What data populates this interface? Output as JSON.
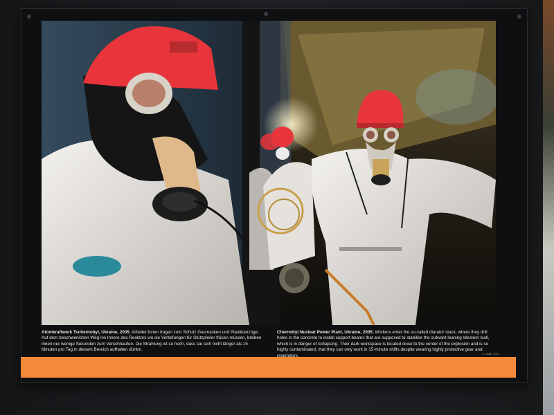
{
  "captions": {
    "german": {
      "title": "Atomkraftwerk Tschernobyl, Ukraine, 2005.",
      "body": "Arbeiter:innen tragen zum Schutz Gasmasken und Plastikanzüge. Auf dem beschwerlichen Weg ins Innere des Reaktors wo sie Vertiefungen für Stützpfeiler fräsen müssen, bleiben ihnen nur wenige Sekunden zum Verschnaufen. Die Strahlung ist so hoch, dass sie sich nicht länger als 15 Minuten pro Tag in diesem Bereich aufhalten dürfen."
    },
    "english": {
      "title": "Chernobyl Nuclear Power Plant, Ukraine, 2005.",
      "body": "Workers enter the so-called diarator stack, where they drill holes in the concrete to install support beams that are supposed to stabilise the outward leaning Western wall, which is in danger of collapsing. Their dark workspace is located close to the center of the explosion and is so highly contaminated, that they can only work in 15-minute shifts despite wearing highly protective gear and respirators."
    }
  },
  "credit": "© DBBR 2021",
  "colors": {
    "accent_bar": "#f58a3a",
    "helmet": "#e8353c",
    "suit": "#e9e6e2"
  }
}
